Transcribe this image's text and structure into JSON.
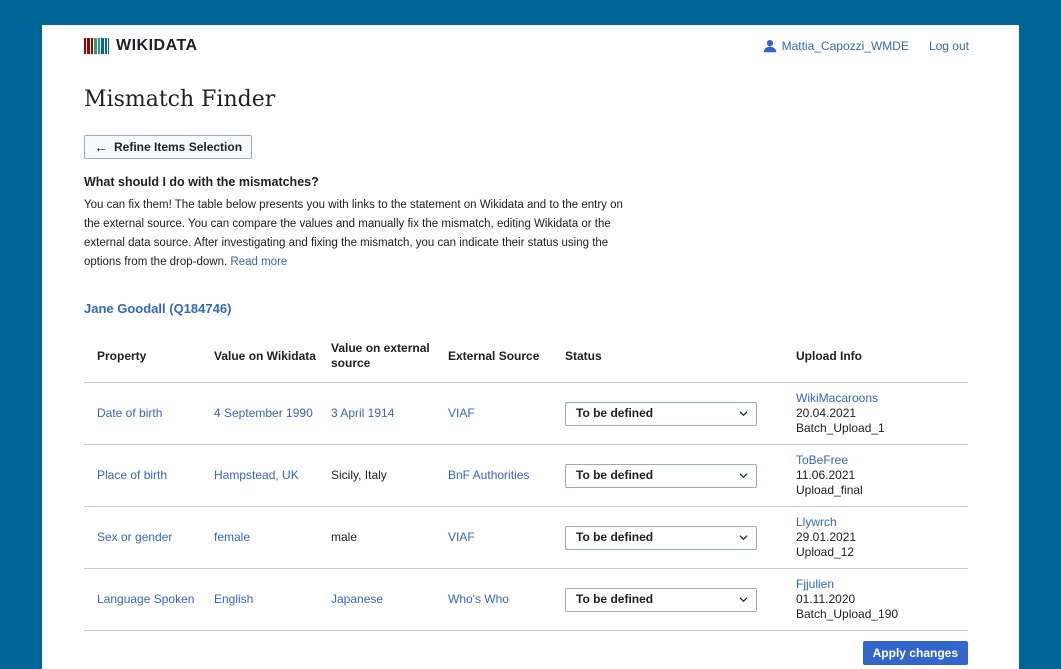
{
  "header": {
    "logo_text": "WIKIDATA",
    "logo_colors": [
      "#990000",
      "#339966",
      "#006699"
    ],
    "username": "Mattia_Capozzi_WMDE",
    "logout": "Log out"
  },
  "page_title": "Mismatch Finder",
  "refine_button": "Refine Items Selection",
  "faq": {
    "title": "What should I do with the mismatches?",
    "text": "You can fix them! The table below presents you with links to the statement on Wikidata and to the entry on the external source. You can compare the values and manually fix the mismatch, editing Wikidata or the external data source. After investigating and fixing the mismatch, you can indicate their status using the options from the drop-down.",
    "read_more": "Read more"
  },
  "item": {
    "title": "Jane Goodall (Q184746)"
  },
  "table": {
    "headers": {
      "property": "Property",
      "wikidata": "Value on Wikidata",
      "external_value": "Value on external source",
      "source": "External Source",
      "status": "Status",
      "upload": "Upload Info"
    },
    "rows": [
      {
        "property": "Date of birth",
        "wikidata": "4 September 1990",
        "external_value": "3 April 1914",
        "source": "VIAF",
        "status": "To be defined",
        "uploader": "WikiMacaroons",
        "date": "20.04.2021",
        "batch": "Batch_Upload_1"
      },
      {
        "property": "Place of birth",
        "wikidata": "Hampstead, UK",
        "external_value": "Sicily, Italy",
        "source": "BnF Authorities",
        "status": "To be defined",
        "uploader": "ToBeFree",
        "date": "11.06.2021",
        "batch": "Upload_final"
      },
      {
        "property": "Sex or gender",
        "wikidata": "female",
        "external_value": "male",
        "source": "VIAF",
        "status": "To be defined",
        "uploader": "Llywrch",
        "date": "29.01.2021",
        "batch": "Upload_12"
      },
      {
        "property": "Language Spoken",
        "wikidata": "English",
        "external_value": "Japanese",
        "source": "Who's Who",
        "status": "To be defined",
        "uploader": "Fjjulien",
        "date": "01.11.2020",
        "batch": "Batch_Upload_190"
      }
    ]
  },
  "apply_button": "Apply changes",
  "colors": {
    "background": "#006699",
    "link": "#3366cc",
    "primary_button": "#3366cc"
  }
}
